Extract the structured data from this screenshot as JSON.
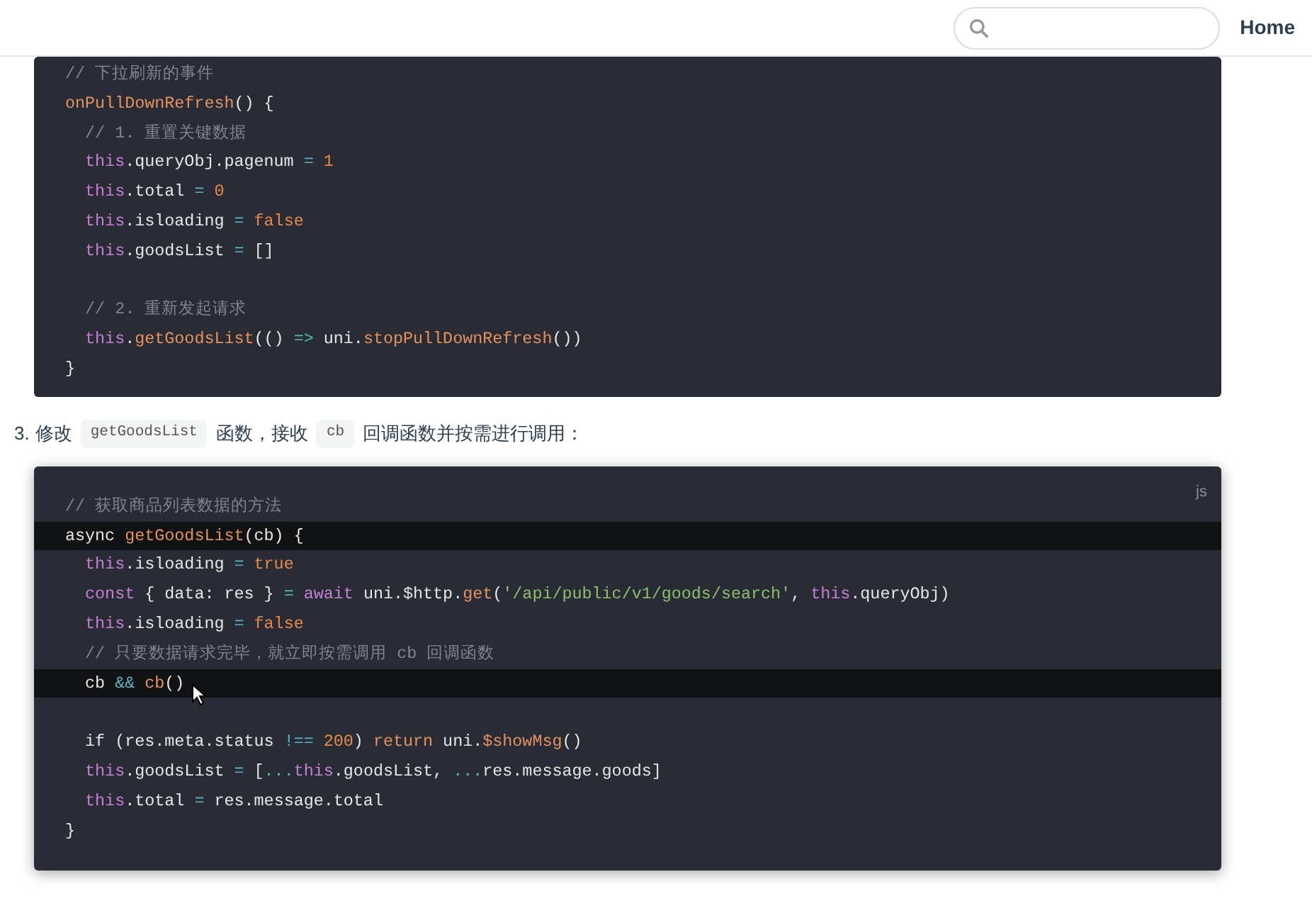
{
  "header": {
    "nav": [
      {
        "label": "Home"
      }
    ]
  },
  "code_blocks": [
    {
      "lines": [
        {
          "highlighted": false,
          "tokens": [
            {
              "kind": "comment",
              "text": "// 下拉刷新的事件"
            }
          ]
        },
        {
          "highlighted": false,
          "tokens": [
            {
              "kind": "function",
              "text": "onPullDownRefresh"
            },
            {
              "kind": "plain",
              "text": "() {"
            }
          ]
        },
        {
          "highlighted": false,
          "tokens": [
            {
              "kind": "comment",
              "text": "  // 1. 重置关键数据"
            }
          ]
        },
        {
          "highlighted": false,
          "tokens": [
            {
              "kind": "keyword",
              "text": "  this"
            },
            {
              "kind": "plain",
              "text": ".queryObj.pagenum "
            },
            {
              "kind": "operator",
              "text": "= "
            },
            {
              "kind": "literal",
              "text": "1"
            }
          ]
        },
        {
          "highlighted": false,
          "tokens": [
            {
              "kind": "keyword",
              "text": "  this"
            },
            {
              "kind": "plain",
              "text": ".total "
            },
            {
              "kind": "operator",
              "text": "= "
            },
            {
              "kind": "literal",
              "text": "0"
            }
          ]
        },
        {
          "highlighted": false,
          "tokens": [
            {
              "kind": "keyword",
              "text": "  this"
            },
            {
              "kind": "plain",
              "text": ".isloading "
            },
            {
              "kind": "operator",
              "text": "= "
            },
            {
              "kind": "literal",
              "text": "false"
            }
          ]
        },
        {
          "highlighted": false,
          "tokens": [
            {
              "kind": "keyword",
              "text": "  this"
            },
            {
              "kind": "plain",
              "text": ".goodsList "
            },
            {
              "kind": "operator",
              "text": "="
            },
            {
              "kind": "plain",
              "text": " []"
            }
          ]
        },
        {
          "highlighted": false
        },
        {
          "highlighted": false,
          "tokens": [
            {
              "kind": "comment",
              "text": "  // 2. 重新发起请求"
            }
          ]
        },
        {
          "highlighted": false,
          "tokens": [
            {
              "kind": "keyword",
              "text": "  this"
            },
            {
              "kind": "plain",
              "text": "."
            },
            {
              "kind": "function",
              "text": "getGoodsList"
            },
            {
              "kind": "plain",
              "text": "(() "
            },
            {
              "kind": "operator",
              "text": "=>"
            },
            {
              "kind": "plain",
              "text": " uni."
            },
            {
              "kind": "function",
              "text": "stopPullDownRefresh"
            },
            {
              "kind": "plain",
              "text": "())"
            }
          ]
        },
        {
          "highlighted": false,
          "tokens": [
            {
              "kind": "plain",
              "text": "}"
            }
          ]
        }
      ]
    },
    {
      "step": {
        "number": "3.",
        "parts": [
          {
            "kind": "text",
            "text": "修改"
          },
          {
            "kind": "code",
            "text": "getGoodsList"
          },
          {
            "kind": "text",
            "text": "函数，接收"
          },
          {
            "kind": "code",
            "text": "cb"
          },
          {
            "kind": "text",
            "text": "回调函数并按需进行调用："
          }
        ]
      },
      "language": "js",
      "lines": [
        {
          "highlighted": false,
          "tokens": [
            {
              "kind": "comment",
              "text": "// 获取商品列表数据的方法"
            }
          ]
        },
        {
          "highlighted": true,
          "tokens": [
            {
              "kind": "plain",
              "text": "async "
            },
            {
              "kind": "function",
              "text": "getGoodsList"
            },
            {
              "kind": "plain",
              "text": "(cb) {"
            }
          ]
        },
        {
          "highlighted": false,
          "tokens": [
            {
              "kind": "keyword",
              "text": "  this"
            },
            {
              "kind": "plain",
              "text": ".isloading "
            },
            {
              "kind": "operator",
              "text": "= "
            },
            {
              "kind": "literal",
              "text": "true"
            }
          ]
        },
        {
          "highlighted": false,
          "tokens": [
            {
              "kind": "keyword",
              "text": "  const"
            },
            {
              "kind": "plain",
              "text": " { data: res } "
            },
            {
              "kind": "operator",
              "text": "= "
            },
            {
              "kind": "keyword",
              "text": "await"
            },
            {
              "kind": "plain",
              "text": " uni.$http."
            },
            {
              "kind": "function",
              "text": "get"
            },
            {
              "kind": "plain",
              "text": "("
            },
            {
              "kind": "string",
              "text": "'/api/public/v1/goods/search'"
            },
            {
              "kind": "plain",
              "text": ", "
            },
            {
              "kind": "keyword",
              "text": "this"
            },
            {
              "kind": "plain",
              "text": ".queryObj)"
            }
          ]
        },
        {
          "highlighted": false,
          "tokens": [
            {
              "kind": "keyword",
              "text": "  this"
            },
            {
              "kind": "plain",
              "text": ".isloading "
            },
            {
              "kind": "operator",
              "text": "= "
            },
            {
              "kind": "literal",
              "text": "false"
            }
          ]
        },
        {
          "highlighted": false,
          "tokens": [
            {
              "kind": "comment",
              "text": "  // 只要数据请求完毕，就立即按需调用 cb 回调函数"
            }
          ]
        },
        {
          "highlighted": true,
          "tokens": [
            {
              "kind": "plain",
              "text": "  cb "
            },
            {
              "kind": "operator",
              "text": "&& "
            },
            {
              "kind": "function",
              "text": "cb"
            },
            {
              "kind": "plain",
              "text": "()"
            }
          ]
        },
        {
          "highlighted": false
        },
        {
          "highlighted": false,
          "tokens": [
            {
              "kind": "plain",
              "text": "  if (res.meta.status "
            },
            {
              "kind": "operator",
              "text": "!== "
            },
            {
              "kind": "literal",
              "text": "200"
            },
            {
              "kind": "plain",
              "text": ") "
            },
            {
              "kind": "function",
              "text": "return"
            },
            {
              "kind": "plain",
              "text": " uni."
            },
            {
              "kind": "function",
              "text": "$showMsg"
            },
            {
              "kind": "plain",
              "text": "()"
            }
          ]
        },
        {
          "highlighted": false,
          "tokens": [
            {
              "kind": "keyword",
              "text": "  this"
            },
            {
              "kind": "plain",
              "text": ".goodsList "
            },
            {
              "kind": "operator",
              "text": "="
            },
            {
              "kind": "plain",
              "text": " ["
            },
            {
              "kind": "operator",
              "text": "..."
            },
            {
              "kind": "keyword",
              "text": "this"
            },
            {
              "kind": "plain",
              "text": ".goodsList, "
            },
            {
              "kind": "operator",
              "text": "..."
            },
            {
              "kind": "plain",
              "text": "res.message.goods]"
            }
          ]
        },
        {
          "highlighted": false,
          "tokens": [
            {
              "kind": "keyword",
              "text": "  this"
            },
            {
              "kind": "plain",
              "text": ".total "
            },
            {
              "kind": "operator",
              "text": "="
            },
            {
              "kind": "plain",
              "text": " res.message.total"
            }
          ]
        },
        {
          "highlighted": false,
          "tokens": [
            {
              "kind": "plain",
              "text": "}"
            }
          ]
        }
      ]
    }
  ]
}
